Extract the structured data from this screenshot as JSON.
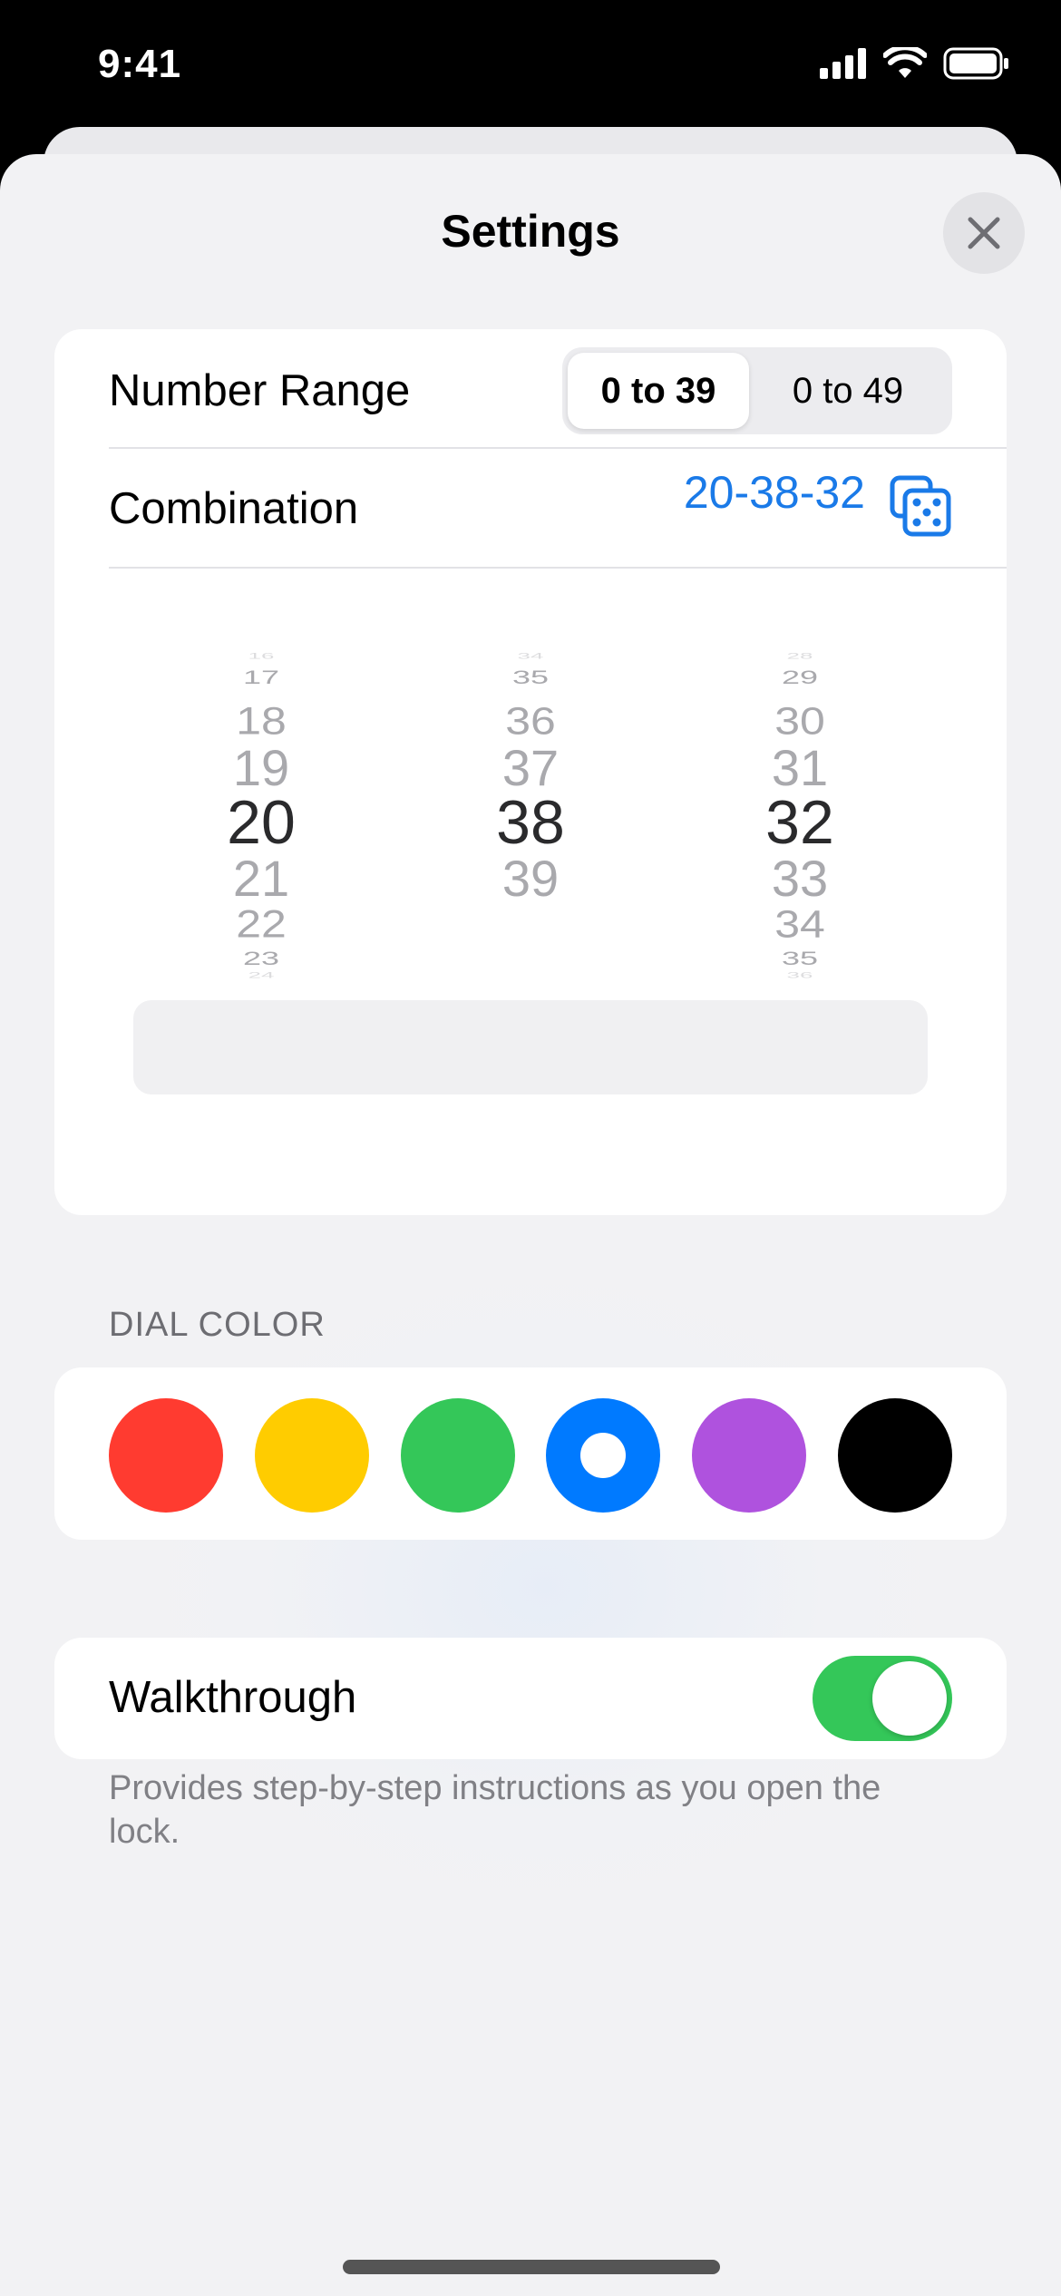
{
  "status_bar": {
    "time": "9:41"
  },
  "title": "Settings",
  "number_range": {
    "label": "Number Range",
    "options": [
      "0 to 39",
      "0 to 49"
    ],
    "selected": "0 to 39"
  },
  "combination": {
    "label": "Combination",
    "value": "20-38-32",
    "icon": "dice-icon"
  },
  "picker": {
    "col1": {
      "above": [
        "16",
        "17",
        "18",
        "19"
      ],
      "selected": "20",
      "below": [
        "21",
        "22",
        "23",
        "24"
      ]
    },
    "col2": {
      "above": [
        "34",
        "35",
        "36",
        "37"
      ],
      "selected": "38",
      "below": [
        "39"
      ]
    },
    "col3": {
      "above": [
        "28",
        "29",
        "30",
        "31"
      ],
      "selected": "32",
      "below": [
        "33",
        "34",
        "35",
        "36"
      ]
    }
  },
  "dial_color": {
    "header": "DIAL COLOR",
    "colors": [
      {
        "name": "red",
        "hex": "#ff3b30"
      },
      {
        "name": "yellow",
        "hex": "#ffcc00"
      },
      {
        "name": "green",
        "hex": "#34c759"
      },
      {
        "name": "blue",
        "hex": "#007aff",
        "selected": true
      },
      {
        "name": "purple",
        "hex": "#af52de"
      },
      {
        "name": "black",
        "hex": "#000000"
      }
    ]
  },
  "walkthrough": {
    "label": "Walkthrough",
    "enabled": true,
    "footer": "Provides step-by-step instructions as you open the lock."
  }
}
